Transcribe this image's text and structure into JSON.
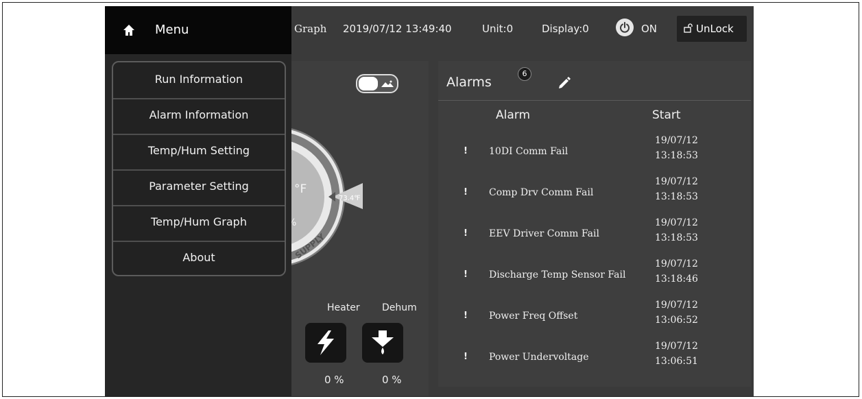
{
  "menu": {
    "title": "Menu",
    "items": [
      {
        "label": "Run Information"
      },
      {
        "label": "Alarm Information"
      },
      {
        "label": "Temp/Hum Setting"
      },
      {
        "label": "Parameter Setting"
      },
      {
        "label": "Temp/Hum Graph"
      },
      {
        "label": "About"
      }
    ]
  },
  "topbar": {
    "graph_label": "Graph",
    "datetime": "2019/07/12 13:49:40",
    "unit": "Unit:0",
    "display": "Display:0",
    "power_status": "ON",
    "lock_label": "UnLock"
  },
  "gauge": {
    "unit_symbol": "°F",
    "setpoint": "73.4℉",
    "percent_partial": "%",
    "ring_label": "SUPPLY"
  },
  "outputs": {
    "heater_label": "Heater",
    "dehum_label": "Dehum",
    "heater_value": "0 %",
    "dehum_value": "0 %"
  },
  "alarms": {
    "title": "Alarms",
    "count": "6",
    "col_alarm": "Alarm",
    "col_start": "Start",
    "rows": [
      {
        "mark": "!",
        "name": "10DI Comm Fail",
        "date": "19/07/12",
        "time": "13:18:53"
      },
      {
        "mark": "!",
        "name": "Comp Drv Comm Fail",
        "date": "19/07/12",
        "time": "13:18:53"
      },
      {
        "mark": "!",
        "name": "EEV Driver Comm Fail",
        "date": "19/07/12",
        "time": "13:18:53"
      },
      {
        "mark": "!",
        "name": "Discharge Temp Sensor Fail",
        "date": "19/07/12",
        "time": "13:18:46"
      },
      {
        "mark": "!",
        "name": "Power Freq Offset",
        "date": "19/07/12",
        "time": "13:06:52"
      },
      {
        "mark": "!",
        "name": "Power Undervoltage",
        "date": "19/07/12",
        "time": "13:06:51"
      }
    ]
  },
  "icons": {
    "home": "home-icon",
    "power": "power-icon",
    "unlock": "unlock-icon",
    "toggle_image": "image-icon",
    "edit": "pencil-icon",
    "heater": "lightning-icon",
    "dehum": "drop-down-arrow-icon"
  },
  "colors": {
    "screen_bg": "#3a3a3a",
    "panel_bg": "#3e3e3e",
    "menu_bg": "#262626",
    "header_bg": "#070707",
    "text": "#f0f0f0"
  }
}
